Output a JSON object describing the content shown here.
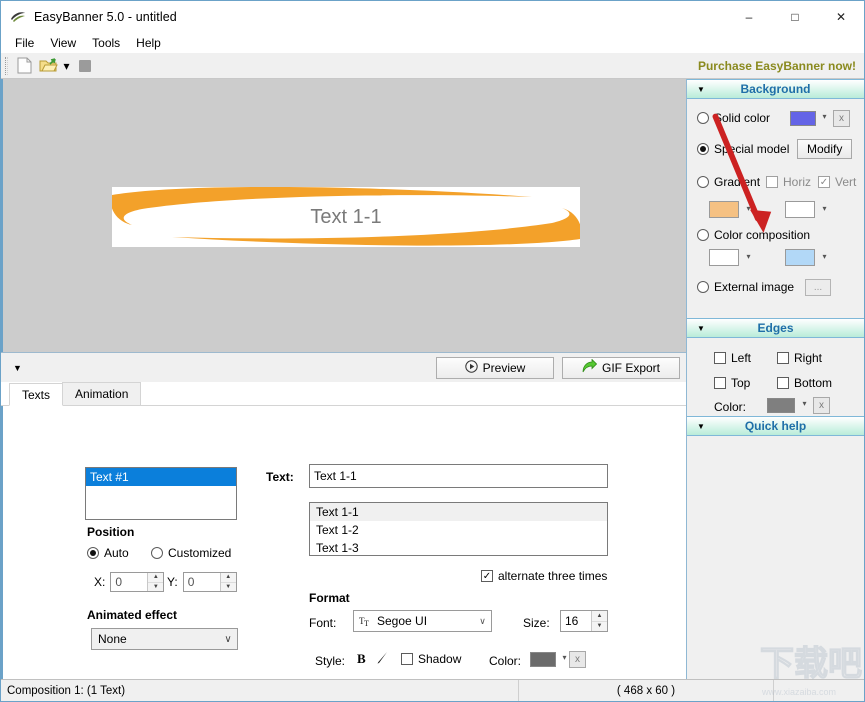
{
  "window": {
    "title": "EasyBanner 5.0 - untitled",
    "app_icon": "banner-swoosh-icon",
    "minimize": "–",
    "maximize": "□",
    "close": "✕"
  },
  "menubar": {
    "items": [
      {
        "label": "File"
      },
      {
        "label": "View"
      },
      {
        "label": "Tools"
      },
      {
        "label": "Help"
      }
    ]
  },
  "toolbar": {
    "new_icon": "new-document-icon",
    "open_icon": "open-folder-icon",
    "open_caret": "▾",
    "save_icon": "save-icon",
    "purchase_label": "Purchase EasyBanner now!"
  },
  "canvas": {
    "banner_text": "Text 1-1",
    "banner_width": 468,
    "banner_height": 60,
    "background_color": "#cccccc",
    "banner_bg": "#ffffff",
    "swoosh_color": "#f3a12a",
    "text_color": "#7a7a7a"
  },
  "preview_bar": {
    "collapse_icon": "▼",
    "preview_label": "Preview",
    "preview_icon": "play-circle-icon",
    "gif_label": "GIF Export",
    "gif_icon": "green-arrow-export-icon"
  },
  "tabs": [
    {
      "label": "Texts",
      "active": true
    },
    {
      "label": "Animation",
      "active": false
    }
  ],
  "texts_tab": {
    "text_list": [
      "Text #1"
    ],
    "position": {
      "legend": "Position",
      "auto_label": "Auto",
      "auto_selected": true,
      "customized_label": "Customized",
      "x_label": "X:",
      "x_value": "0",
      "y_label": "Y:",
      "y_value": "0"
    },
    "animated_effect": {
      "legend": "Animated effect",
      "value": "None",
      "caret": "∨"
    },
    "text_field": {
      "label": "Text:",
      "value": "Text 1-1"
    },
    "variants": [
      "Text 1-1",
      "Text 1-2",
      "Text 1-3"
    ],
    "alternate": {
      "label": "alternate three times",
      "checked": true,
      "check_glyph": "✓"
    },
    "format": {
      "legend": "Format",
      "font_label": "Font:",
      "font_value": "Segoe UI",
      "font_icon": "font-tt-icon",
      "font_caret": "∨",
      "size_label": "Size:",
      "size_value": "16",
      "style_label": "Style:",
      "bold_glyph": "B",
      "italic_icon": "italic-icon",
      "shadow_label": "Shadow",
      "shadow_checked": false,
      "color_label": "Color:",
      "color_swatch": "#6b6b6b",
      "color_caret": "▾",
      "clear_label": "x"
    }
  },
  "right_panel": {
    "background_section": {
      "title": "Background",
      "collapse_icon": "▼",
      "solid_color": {
        "label": "Solid color",
        "selected": false,
        "swatch": "#6464e6",
        "caret": "▾",
        "clear_label": "x"
      },
      "special_model": {
        "label": "Special model",
        "selected": true,
        "button_label": "Modify"
      },
      "gradient": {
        "label": "Gradient",
        "selected": false,
        "horiz_label": "Horiz",
        "horiz_checked": false,
        "vert_label": "Vert",
        "vert_checked": true,
        "vert_check_glyph": "✓",
        "swatch1": "#f5c183",
        "swatch2": "#ffffff",
        "caret": "▾"
      },
      "color_composition": {
        "label": "Color composition",
        "selected": false,
        "swatch1": "#ffffff",
        "swatch2": "#b2d8f7",
        "caret": "▾"
      },
      "external_image": {
        "label": "External image",
        "selected": false,
        "browse_label": "..."
      }
    },
    "edges_section": {
      "title": "Edges",
      "collapse_icon": "▼",
      "left_label": "Left",
      "left_checked": false,
      "right_label": "Right",
      "right_checked": false,
      "top_label": "Top",
      "top_checked": false,
      "bottom_label": "Bottom",
      "bottom_checked": false,
      "color_label": "Color:",
      "color_swatch": "#7f7f7f",
      "color_caret": "▾",
      "clear_label": "x"
    },
    "quick_help_section": {
      "title": "Quick help",
      "collapse_icon": "▼"
    },
    "annotation_arrow": {
      "color": "#cc2222",
      "points_to": "Edges"
    }
  },
  "statusbar": {
    "composition": "Composition 1:  (1 Text)",
    "dimensions": "( 468 x 60 )"
  },
  "watermark": {
    "url_text": "www.xiazaiba.com",
    "logo_text": "下载吧"
  }
}
